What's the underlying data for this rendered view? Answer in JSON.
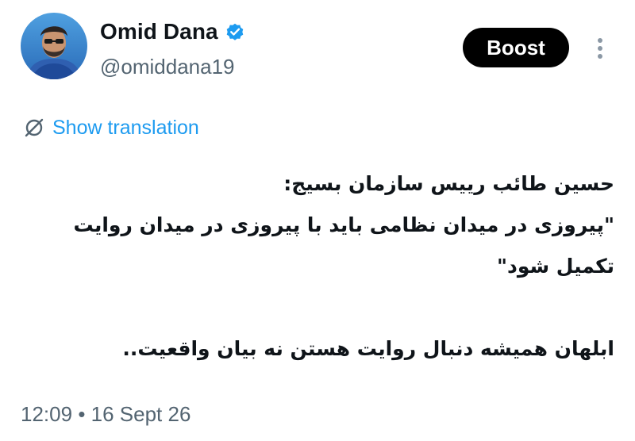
{
  "author": {
    "display_name": "Omid Dana",
    "handle": "@omiddana19",
    "verified_color": "#1d9bf0",
    "avatar_icon": "profile-photo-icon"
  },
  "actions": {
    "boost_label": "Boost",
    "more_icon": "vertical-ellipsis-icon"
  },
  "translation": {
    "icon": "translate-slashed-icon",
    "label": "Show translation"
  },
  "tweet": {
    "lines": [
      "حسین طائب رییس سازمان بسیج:",
      "\"پیروزی در میدان نظامی باید با پیروزی در میدان روایت",
      "تکمیل شود\"",
      "",
      "ابلهان همیشه دنبال روایت هستن نه بیان واقعیت.."
    ]
  },
  "meta": {
    "time": "12:09",
    "separator": "•",
    "date": "16 Sept 26"
  },
  "colors": {
    "accent": "#1d9bf0",
    "text_primary": "#0f1419",
    "text_secondary": "#536471",
    "button_bg": "#000000"
  }
}
